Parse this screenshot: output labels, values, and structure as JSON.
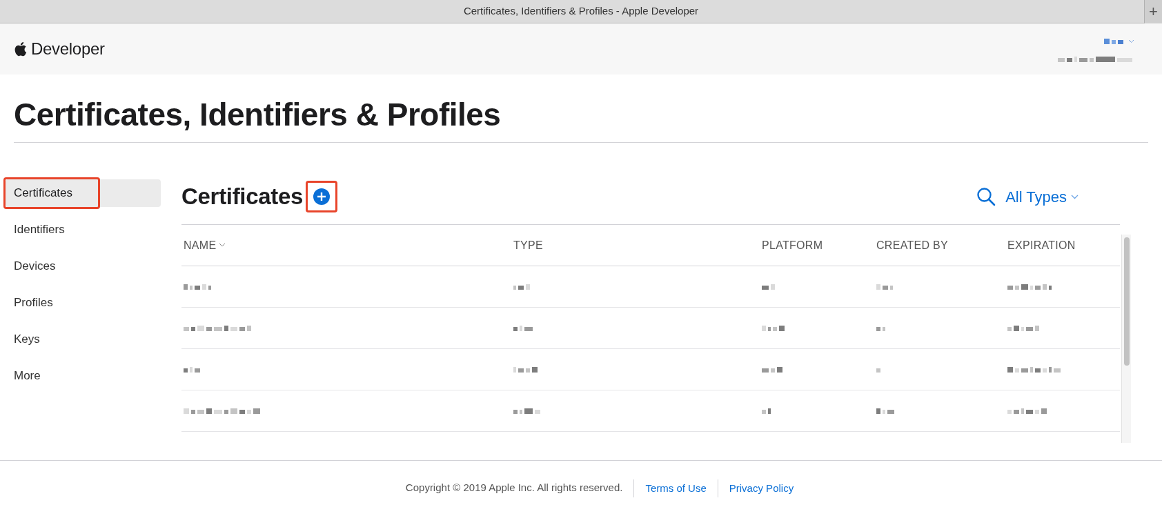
{
  "window": {
    "title": "Certificates, Identifiers & Profiles - Apple Developer",
    "new_tab": "+"
  },
  "header": {
    "brand": "Developer",
    "account": {
      "kind": "redacted"
    }
  },
  "page_title": "Certificates, Identifiers & Profiles",
  "sidebar": {
    "items": [
      {
        "label": "Certificates",
        "selected": true,
        "highlighted": true
      },
      {
        "label": "Identifiers",
        "selected": false,
        "highlighted": false
      },
      {
        "label": "Devices",
        "selected": false,
        "highlighted": false
      },
      {
        "label": "Profiles",
        "selected": false,
        "highlighted": false
      },
      {
        "label": "Keys",
        "selected": false,
        "highlighted": false
      },
      {
        "label": "More",
        "selected": false,
        "highlighted": false
      }
    ]
  },
  "section": {
    "title": "Certificates",
    "add_highlighted": true,
    "filter": "All Types"
  },
  "table": {
    "columns": [
      {
        "label": "NAME",
        "sortable": true
      },
      {
        "label": "TYPE",
        "sortable": false
      },
      {
        "label": "PLATFORM",
        "sortable": false
      },
      {
        "label": "CREATED BY",
        "sortable": false
      },
      {
        "label": "EXPIRATION",
        "sortable": false
      }
    ],
    "rows": [
      {
        "kind": "redacted"
      },
      {
        "kind": "redacted"
      },
      {
        "kind": "redacted"
      },
      {
        "kind": "redacted"
      }
    ]
  },
  "footer": {
    "copyright": "Copyright © 2019 Apple Inc. All rights reserved.",
    "links": [
      "Terms of Use",
      "Privacy Policy"
    ]
  }
}
